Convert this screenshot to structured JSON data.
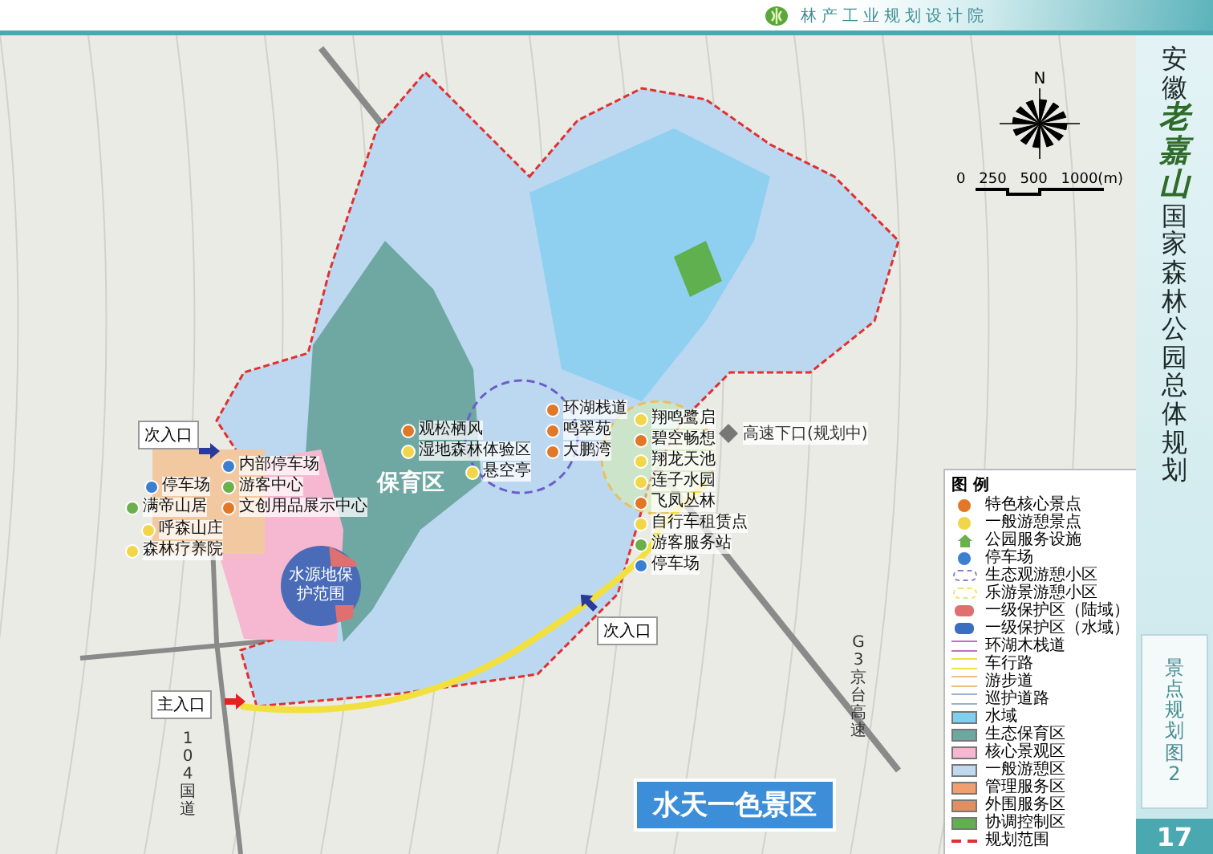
{
  "header": {
    "org": "林产工业规划设计院"
  },
  "sidebar": {
    "title_prefix": "安徽",
    "title_brand": "老嘉山",
    "title_suffix": "国家森林公园总体规划",
    "sheet_title": "景点规划图2",
    "page": "17"
  },
  "map": {
    "zone_label": "保育区",
    "water_source_label": "水源地保护范围",
    "banner": "水天一色景区",
    "highway_exit": "高速下口(规划中)",
    "road_104": "104国道",
    "road_g3": "G3京台高速",
    "entrances": [
      {
        "label": "次入口",
        "kind": "secondary"
      },
      {
        "label": "次入口",
        "kind": "secondary"
      },
      {
        "label": "主入口",
        "kind": "main"
      }
    ],
    "places": [
      {
        "label": "内部停车场",
        "color": "#3a7fd0"
      },
      {
        "label": "游客中心",
        "color": "#6ab04c"
      },
      {
        "label": "文创用品展示中心",
        "color": "#e07828"
      },
      {
        "label": "停车场",
        "color": "#3a7fd0"
      },
      {
        "label": "满帝山居",
        "color": "#6ab04c"
      },
      {
        "label": "呼森山庄",
        "color": "#f2d64a"
      },
      {
        "label": "森林疗养院",
        "color": "#f2d64a"
      },
      {
        "label": "观松栖风",
        "color": "#e07828"
      },
      {
        "label": "湿地森林体验区",
        "color": "#f2d64a"
      },
      {
        "label": "悬空亭",
        "color": "#f2d64a"
      },
      {
        "label": "环湖栈道",
        "color": "#e07828"
      },
      {
        "label": "鸣翠苑",
        "color": "#e07828"
      },
      {
        "label": "大鹏湾",
        "color": "#e07828"
      },
      {
        "label": "翔鸣鹭启",
        "color": "#f2d64a"
      },
      {
        "label": "碧空畅想",
        "color": "#e07828"
      },
      {
        "label": "翔龙天池",
        "color": "#f2d64a"
      },
      {
        "label": "连子水园",
        "color": "#f2d64a"
      },
      {
        "label": "飞凤丛林",
        "color": "#e07828"
      },
      {
        "label": "自行车租赁点",
        "color": "#f2d64a"
      },
      {
        "label": "游客服务站",
        "color": "#6ab04c"
      },
      {
        "label": "停车场",
        "color": "#3a7fd0"
      }
    ]
  },
  "compass": {
    "north": "N",
    "scale": [
      "0",
      "250",
      "500",
      "1000(m)"
    ]
  },
  "legend": {
    "title": "图 例",
    "items": [
      {
        "label": "特色核心景点",
        "kind": "dot",
        "color": "#e07828"
      },
      {
        "label": "一般游憩景点",
        "kind": "dot",
        "color": "#f2d64a"
      },
      {
        "label": "公园服务设施",
        "kind": "house",
        "color": "#6ab04c"
      },
      {
        "label": "停车场",
        "kind": "dot",
        "color": "#3a7fd0"
      },
      {
        "label": "生态观游憩小区",
        "kind": "zone",
        "color": "#8a7fd0"
      },
      {
        "label": "乐游景游憩小区",
        "kind": "zone",
        "color": "#f2e070"
      },
      {
        "label": "一级保护区（陆域）",
        "kind": "swatch",
        "color": "#e07070"
      },
      {
        "label": "一级保护区（水域）",
        "kind": "swatch",
        "color": "#3a6fc0"
      },
      {
        "label": "环湖木栈道",
        "kind": "line",
        "color": "#c070c0"
      },
      {
        "label": "车行路",
        "kind": "line",
        "color": "#f2e040"
      },
      {
        "label": "游步道",
        "kind": "line",
        "color": "#f0c080"
      },
      {
        "label": "巡护道路",
        "kind": "line",
        "color": "#9ab0d0"
      },
      {
        "label": "水域",
        "kind": "fill",
        "color": "#7fd0f0"
      },
      {
        "label": "生态保育区",
        "kind": "fill",
        "color": "#6aa8a0"
      },
      {
        "label": "核心景观区",
        "kind": "fill",
        "color": "#f5b8d0"
      },
      {
        "label": "一般游憩区",
        "kind": "fill",
        "color": "#c0d8f0"
      },
      {
        "label": "管理服务区",
        "kind": "fill",
        "color": "#f0a070"
      },
      {
        "label": "外围服务区",
        "kind": "fill",
        "color": "#e09060"
      },
      {
        "label": "协调控制区",
        "kind": "fill",
        "color": "#60b050"
      },
      {
        "label": "规划范围",
        "kind": "boundary",
        "color": "#e03030"
      }
    ]
  }
}
